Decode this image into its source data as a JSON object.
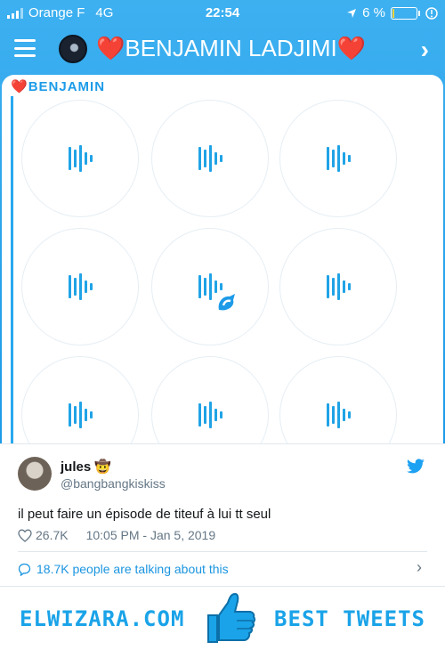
{
  "status_bar": {
    "carrier": "Orange F",
    "network": "4G",
    "time": "22:54",
    "battery_percent": "6 %",
    "battery_level": 0.06
  },
  "nav": {
    "title": "BENJAMIN LADJIMI",
    "heart_left": "❤️",
    "heart_right": "❤️",
    "next_icon": "chevron-right-icon"
  },
  "chat": {
    "sender": "BENJAMIN",
    "sender_heart": "❤️",
    "voice_messages_count": 9
  },
  "tweet": {
    "name": "jules",
    "name_emoji": "🤠",
    "handle": "@bangbangkiskiss",
    "text": "il peut faire un épisode de titeuf à lui tt seul",
    "likes": "26.7K",
    "timestamp": "10:05 PM - Jan 5, 2019",
    "talking": "18.7K people are talking about this"
  },
  "footer": {
    "site": "ELWIZARA.COM",
    "tagline": "BEST TWEETS"
  },
  "colors": {
    "accent": "#1d9be8",
    "heart": "#e11d2a",
    "twitter_blue": "#1b95e0"
  }
}
